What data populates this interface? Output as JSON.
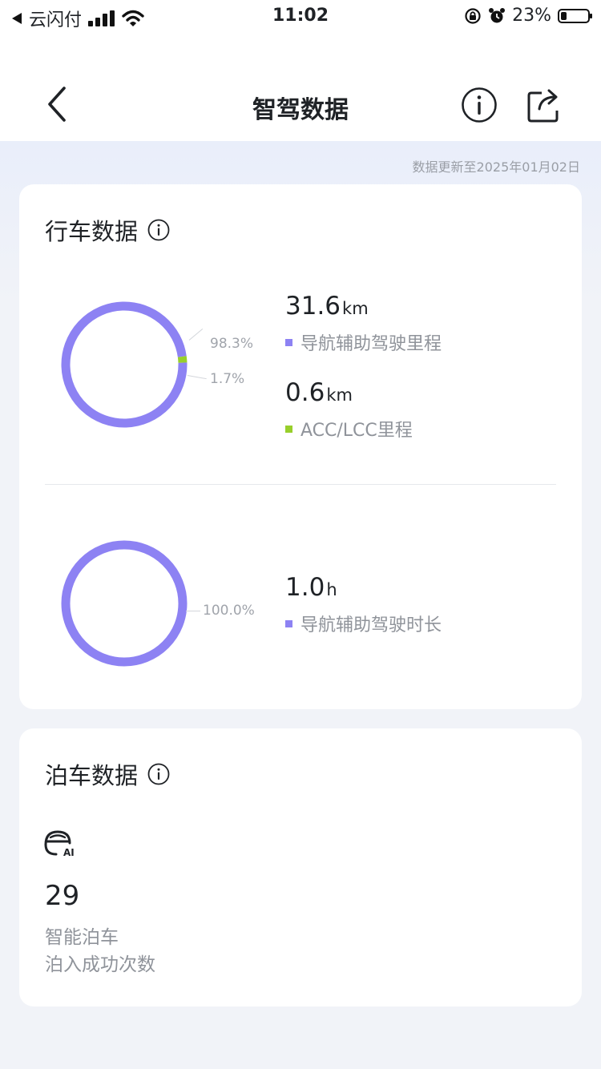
{
  "status_bar": {
    "back_app": "云闪付",
    "time": "11:02",
    "battery_percent": "23%",
    "battery_level": 0.23
  },
  "nav": {
    "title": "智驾数据"
  },
  "update_note": "数据更新至2025年01月02日",
  "driving": {
    "title": "行车数据",
    "mileage_chart": {
      "segments": [
        {
          "label": "98.3%",
          "fraction": 0.983,
          "color": "#8d82f3"
        },
        {
          "label": "1.7%",
          "fraction": 0.017,
          "color": "#98cf2b"
        }
      ],
      "metrics": [
        {
          "value": "31.6",
          "unit": "km",
          "legend": "导航辅助驾驶里程",
          "color": "#8d82f3"
        },
        {
          "value": "0.6",
          "unit": "km",
          "legend": "ACC/LCC里程",
          "color": "#98cf2b"
        }
      ]
    },
    "duration_chart": {
      "segments": [
        {
          "label": "100.0%",
          "fraction": 1.0,
          "color": "#8d82f3"
        }
      ],
      "metrics": [
        {
          "value": "1.0",
          "unit": "h",
          "legend": "导航辅助驾驶时长",
          "color": "#8d82f3"
        }
      ]
    }
  },
  "parking": {
    "title": "泊车数据",
    "icon_text": "AI",
    "count": "29",
    "label_line1": "智能泊车",
    "label_line2": "泊入成功次数"
  }
}
